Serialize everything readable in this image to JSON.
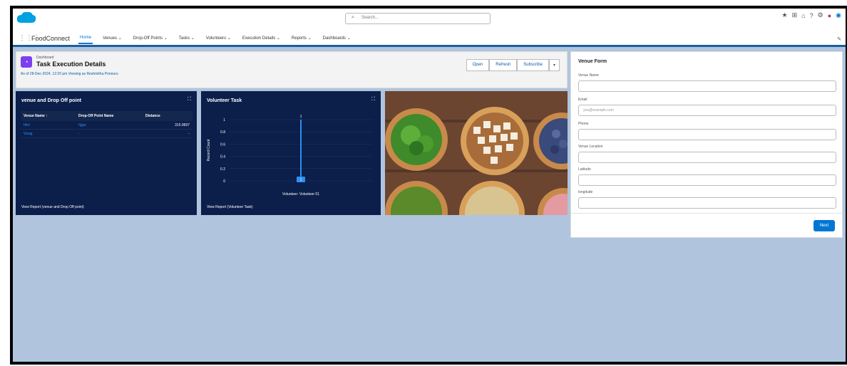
{
  "search": {
    "placeholder": "Search..."
  },
  "nav": {
    "app_name": "FoodConnect",
    "items": [
      {
        "label": "Home"
      },
      {
        "label": "Venues"
      },
      {
        "label": "Drop-Off Points"
      },
      {
        "label": "Tasks"
      },
      {
        "label": "Volunteers"
      },
      {
        "label": "Execution Details"
      },
      {
        "label": "Reports"
      },
      {
        "label": "Dashboards"
      }
    ]
  },
  "dashboard": {
    "type_label": "Dashboard",
    "title": "Task Execution Details",
    "meta": "As of 28-Dec-2024, 12:20 pm·Viewing as Reshmitha Ponnuru",
    "buttons": {
      "open": "Open",
      "refresh": "Refresh",
      "subscribe": "Subscribe"
    }
  },
  "panel_venue": {
    "title": "venue and Drop Off point",
    "columns": [
      "Venue Name ↑",
      "Drop-Off Point Name",
      "Distance"
    ],
    "rows": [
      [
        "hfrrr",
        "hjgiu",
        "315.9697"
      ],
      [
        "Vizag",
        "-",
        "-"
      ]
    ],
    "link": "View Report (venue and Drop Off point)"
  },
  "panel_task": {
    "title": "Volunteer Task",
    "link": "View Report (Volunteer Task)"
  },
  "chart_data": {
    "type": "bar",
    "categories": [
      "Volunteer: Volunteer 01"
    ],
    "values": [
      1
    ],
    "ylabel": "Record Count",
    "ylim": [
      0,
      1
    ],
    "yticks": [
      "1",
      "0.8",
      "0.6",
      "0.4",
      "0.2",
      "0"
    ],
    "data_labels": [
      "1"
    ],
    "category_tag": "1"
  },
  "form": {
    "title": "Venue Form",
    "fields": [
      {
        "label": "Venue Name",
        "placeholder": ""
      },
      {
        "label": "Email",
        "placeholder": "you@example.com"
      },
      {
        "label": "Phone",
        "placeholder": ""
      },
      {
        "label": "Venue Location",
        "placeholder": ""
      },
      {
        "label": "Latitude",
        "placeholder": ""
      },
      {
        "label": "longitude",
        "placeholder": ""
      }
    ],
    "next_label": "Next"
  },
  "colors": {
    "brand": "#0176d3",
    "panel": "#0b1f4a",
    "background": "#b0c4de"
  },
  "icons": [
    "salesforce-cloud-icon",
    "search-icon",
    "app-launcher-icon",
    "favorites-icon",
    "help-icon",
    "settings-icon",
    "notification-bell-icon",
    "avatar-icon",
    "pencil-icon",
    "dashboard-icon",
    "expand-icon"
  ]
}
